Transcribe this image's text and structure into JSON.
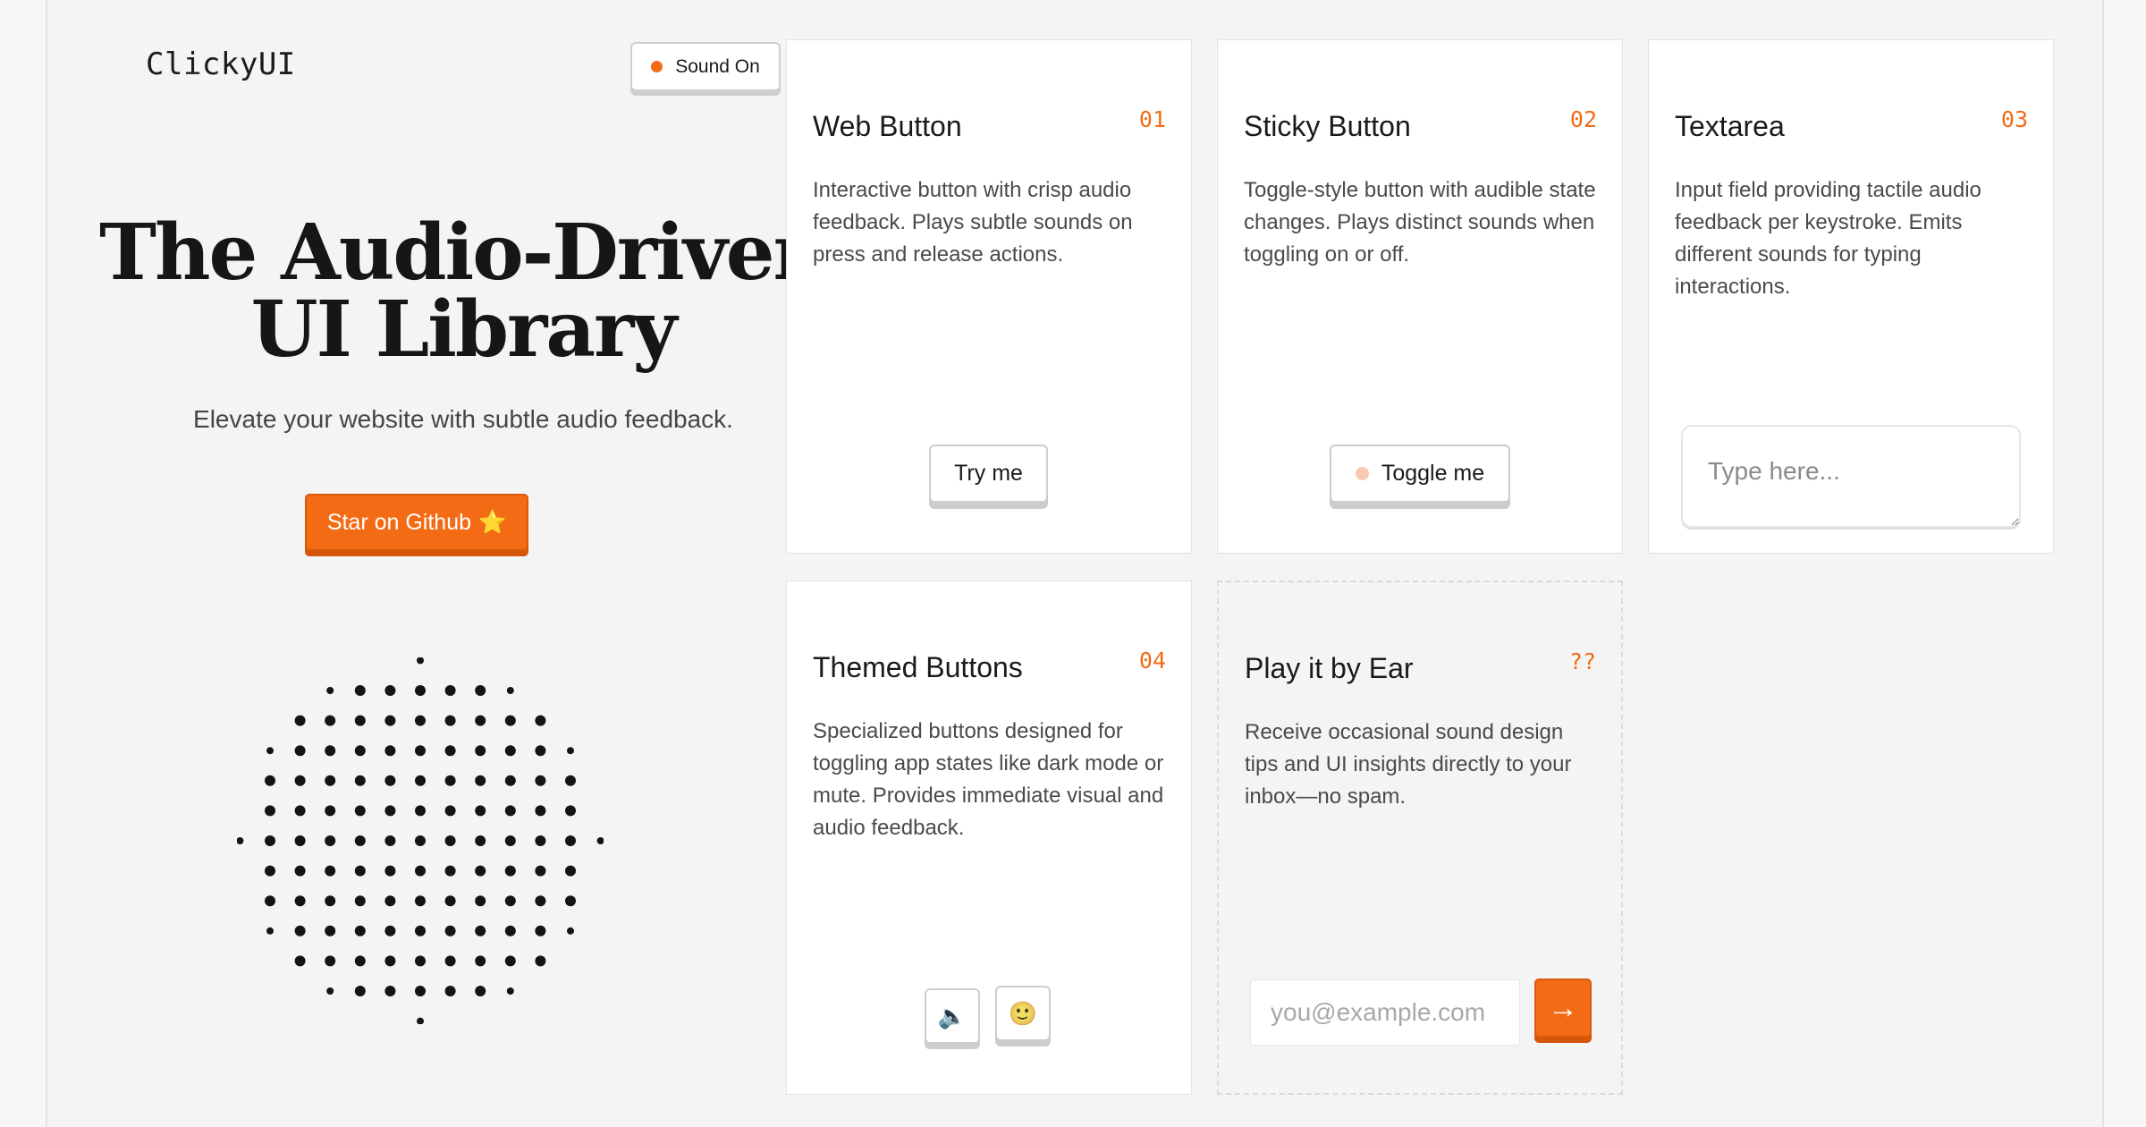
{
  "brand": {
    "logo": "ClickyUI"
  },
  "sound_toggle": {
    "label": "Sound On"
  },
  "hero": {
    "title_line1": "The Audio-Driven",
    "title_line2": "UI Library",
    "subtitle": "Elevate your website with subtle audio feedback.",
    "cta_label": "Star on Github",
    "cta_icon": "⭐"
  },
  "cards": {
    "web_button": {
      "title": "Web Button",
      "num": "01",
      "desc": "Interactive button with crisp audio feedback. Plays subtle sounds on press and release actions.",
      "button_label": "Try me"
    },
    "sticky_button": {
      "title": "Sticky Button",
      "num": "02",
      "desc": "Toggle-style button with audible state changes. Plays distinct sounds when toggling on or off.",
      "button_label": "Toggle me"
    },
    "textarea": {
      "title": "Textarea",
      "num": "03",
      "desc": "Input field providing tactile audio feedback per keystroke. Emits different sounds for typing interactions.",
      "placeholder": "Type here..."
    },
    "themed_buttons": {
      "title": "Themed Buttons",
      "num": "04",
      "desc": "Specialized buttons designed for toggling app states like dark mode or mute. Provides immediate visual and audio feedback.",
      "mute_icon": "🔈",
      "theme_icon": "🙂"
    },
    "newsletter": {
      "title": "Play it by Ear",
      "num": "??",
      "desc": "Receive occasional sound design tips and UI insights directly to your inbox—no spam.",
      "email_placeholder": "you@example.com",
      "submit_label": "→"
    }
  },
  "colors": {
    "accent": "#f36c15",
    "background": "#f4f4f4",
    "card": "#ffffff"
  }
}
